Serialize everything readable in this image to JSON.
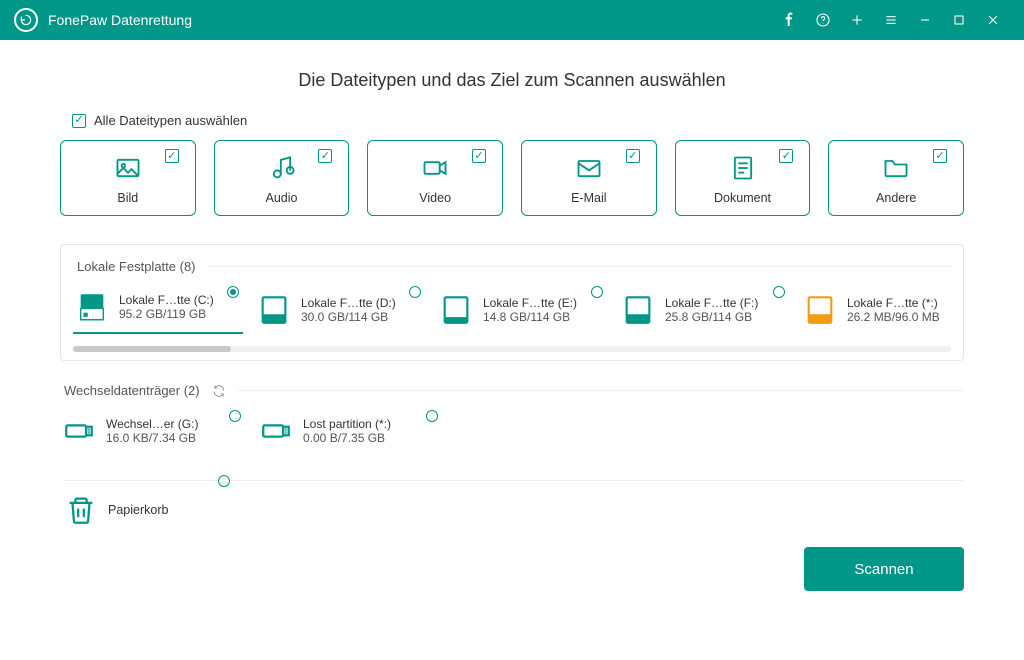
{
  "app": {
    "title": "FonePaw Datenrettung"
  },
  "page": {
    "heading": "Die Dateitypen und das Ziel zum Scannen auswählen",
    "select_all_label": "Alle Dateitypen auswählen"
  },
  "types": [
    {
      "key": "image",
      "label": "Bild",
      "checked": true
    },
    {
      "key": "audio",
      "label": "Audio",
      "checked": true
    },
    {
      "key": "video",
      "label": "Video",
      "checked": true
    },
    {
      "key": "email",
      "label": "E-Mail",
      "checked": true
    },
    {
      "key": "document",
      "label": "Dokument",
      "checked": true
    },
    {
      "key": "other",
      "label": "Andere",
      "checked": true
    }
  ],
  "sections": {
    "local": {
      "label": "Lokale Festplatte (8)"
    },
    "removable": {
      "label": "Wechseldatenträger (2)"
    }
  },
  "local_drives": [
    {
      "name": "Lokale F…tte (C:)",
      "size": "95.2 GB/119 GB",
      "selected": true,
      "color": "#009688"
    },
    {
      "name": "Lokale F…tte (D:)",
      "size": "30.0 GB/114 GB",
      "selected": false,
      "color": "#009688"
    },
    {
      "name": "Lokale F…tte (E:)",
      "size": "14.8 GB/114 GB",
      "selected": false,
      "color": "#009688"
    },
    {
      "name": "Lokale F…tte (F:)",
      "size": "25.8 GB/114 GB",
      "selected": false,
      "color": "#009688"
    },
    {
      "name": "Lokale F…tte (*:)",
      "size": "26.2 MB/96.0 MB",
      "selected": false,
      "color": "#f39c12"
    }
  ],
  "removable_drives": [
    {
      "name": "Wechsel…er (G:)",
      "size": "16.0 KB/7.34 GB",
      "selected": false
    },
    {
      "name": "Lost partition (*:)",
      "size": "0.00  B/7.35 GB",
      "selected": false
    }
  ],
  "trash": {
    "label": "Papierkorb",
    "selected": false
  },
  "scan_button": "Scannen"
}
